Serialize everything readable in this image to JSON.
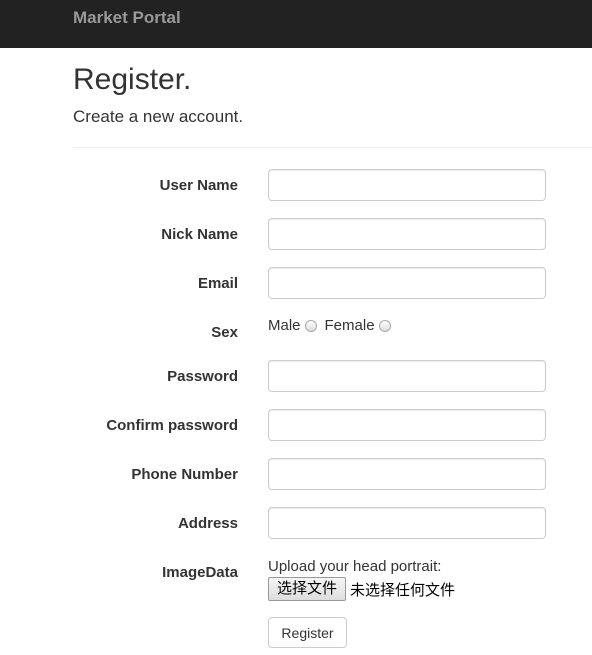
{
  "navbar": {
    "brand": "Market Portal"
  },
  "header": {
    "title": "Register.",
    "subtitle": "Create a new account."
  },
  "form": {
    "user_name_label": "User Name",
    "nick_name_label": "Nick Name",
    "email_label": "Email",
    "sex_label": "Sex",
    "sex_options": [
      "Male",
      "Female"
    ],
    "password_label": "Password",
    "confirm_password_label": "Confirm password",
    "phone_label": "Phone Number",
    "address_label": "Address",
    "image_label": "ImageData",
    "upload_hint": "Upload your head portrait:",
    "file_button": "选择文件",
    "file_status": "未选择任何文件",
    "submit_label": "Register"
  }
}
